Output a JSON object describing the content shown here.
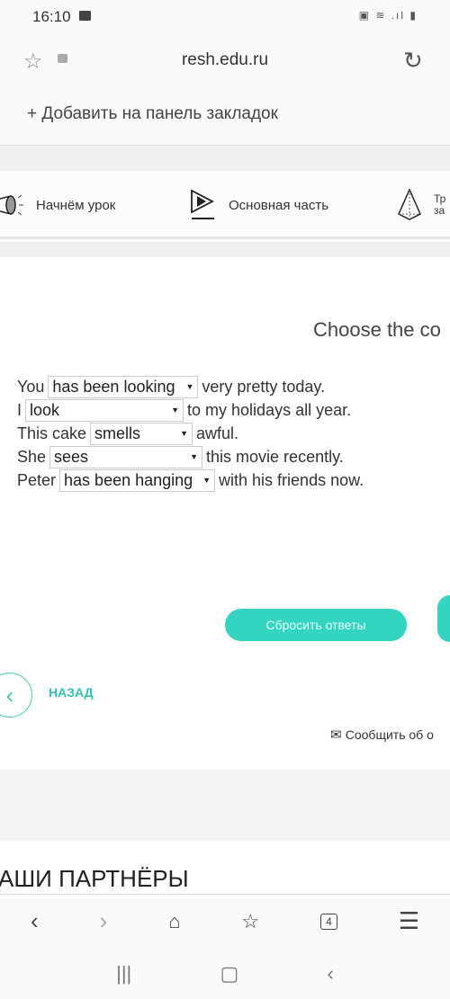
{
  "status_bar": {
    "time": "16:10",
    "icons": [
      "gallery-icon",
      "battery-saver-icon",
      "wifi-icon",
      "signal-icon",
      "battery-icon"
    ]
  },
  "browser": {
    "url": "resh.edu.ru",
    "add_bookmark": "Добавить на панель закладок"
  },
  "steps": [
    {
      "label": "Начнём урок",
      "icon": "megaphone-icon"
    },
    {
      "label": "Основная часть",
      "icon": "play-icon"
    },
    {
      "label": "Тр за",
      "icon": "pyramid-icon"
    }
  ],
  "exercise": {
    "title": "Choose the co",
    "sentences": [
      {
        "before": "You",
        "selected": "has been looking",
        "after": "very pretty today."
      },
      {
        "before": "I",
        "selected": "look",
        "after": "to my holidays all year."
      },
      {
        "before": "This cake",
        "selected": "smells",
        "after": "awful."
      },
      {
        "before": "She",
        "selected": "sees",
        "after": "this movie recently."
      },
      {
        "before": "Peter",
        "selected": "has been hanging",
        "after": "with his friends now."
      }
    ],
    "reset_label": "Сбросить ответы",
    "back_label": "НАЗАД",
    "report_label": "Сообщить об о"
  },
  "partners_heading": "АШИ ПАРТНЁРЫ",
  "bottom_nav": {
    "tabs_count": "4"
  },
  "colors": {
    "accent": "#33d4c0"
  }
}
